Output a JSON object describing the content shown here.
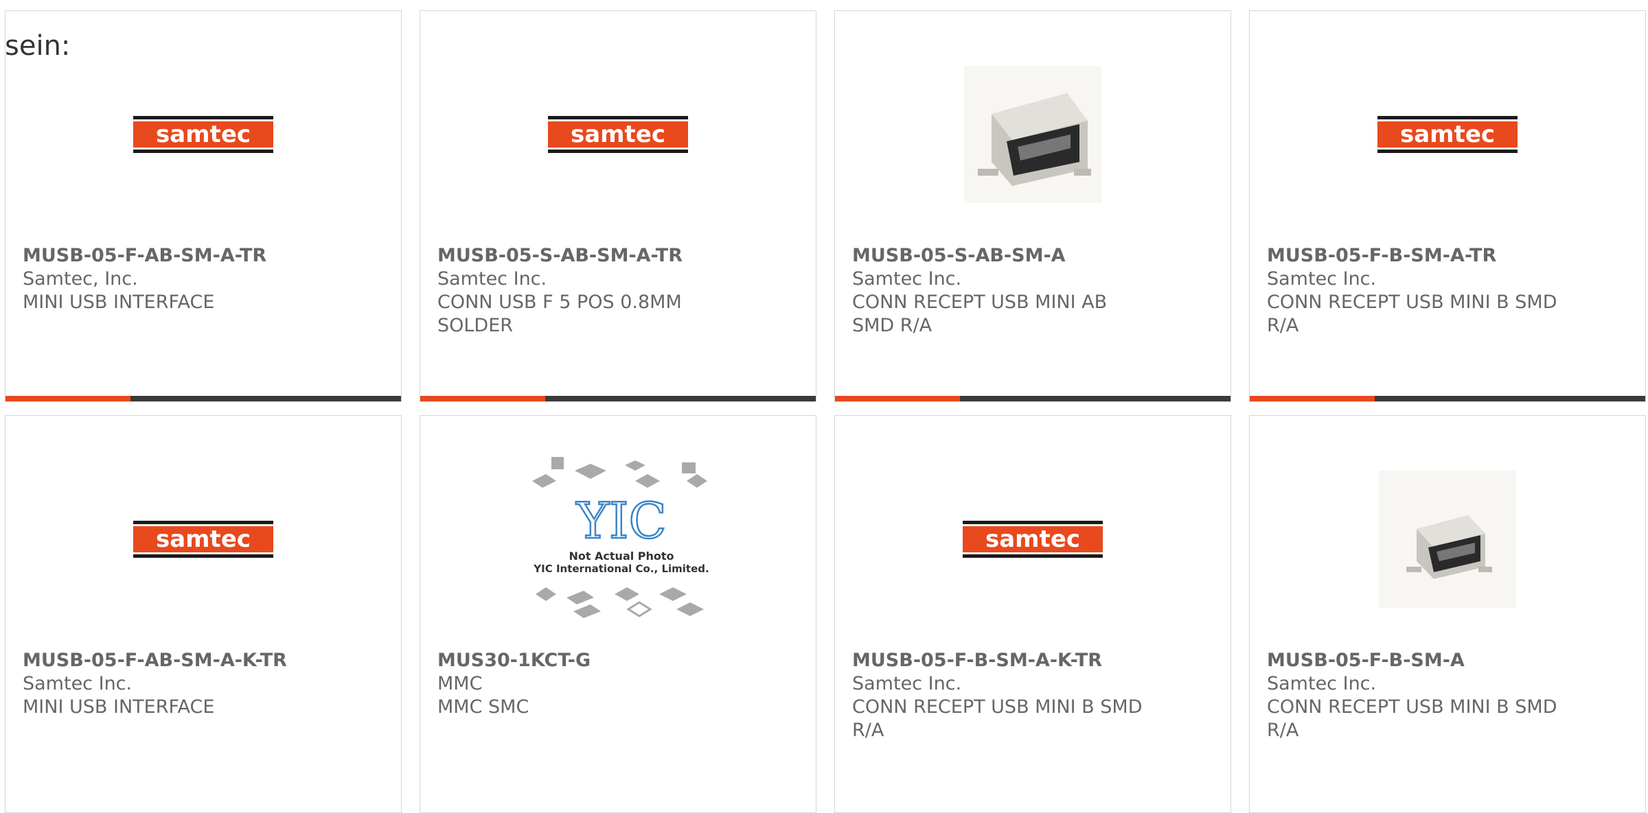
{
  "lead_text": "sein:",
  "colors": {
    "accent": "#e8491d",
    "bar_dark": "#3a3a3a",
    "samtec_orange": "#e8491d",
    "text": "#666666"
  },
  "products": [
    {
      "part": "MUSB-05-F-AB-SM-A-TR",
      "maker": "Samtec, Inc.",
      "desc": "MINI USB INTERFACE",
      "image": "samtec-logo"
    },
    {
      "part": "MUSB-05-S-AB-SM-A-TR",
      "maker": "Samtec Inc.",
      "desc": "CONN USB F 5 POS 0.8MM SOLDER",
      "image": "samtec-logo"
    },
    {
      "part": "MUSB-05-S-AB-SM-A",
      "maker": "Samtec Inc.",
      "desc": "CONN RECEPT USB MINI AB SMD R/A",
      "image": "usb-connector-photo"
    },
    {
      "part": "MUSB-05-F-B-SM-A-TR",
      "maker": "Samtec Inc.",
      "desc": "CONN RECEPT USB MINI B SMD R/A",
      "image": "samtec-logo"
    },
    {
      "part": "MUSB-05-F-AB-SM-A-K-TR",
      "maker": "Samtec Inc.",
      "desc": "MINI USB INTERFACE",
      "image": "samtec-logo"
    },
    {
      "part": "MUS30-1KCT-G",
      "maker": "MMC",
      "desc": "MMC SMC",
      "image": "yic-placeholder"
    },
    {
      "part": "MUSB-05-F-B-SM-A-K-TR",
      "maker": "Samtec Inc.",
      "desc": "CONN RECEPT USB MINI B SMD R/A",
      "image": "samtec-logo"
    },
    {
      "part": "MUSB-05-F-B-SM-A",
      "maker": "Samtec Inc.",
      "desc": "CONN RECEPT USB MINI B SMD R/A",
      "image": "usb-connector-photo"
    }
  ],
  "logos": {
    "samtec": "samtec",
    "yic": "YIC",
    "yic_note_1": "Not Actual Photo",
    "yic_note_2": "YIC International Co., Limited."
  }
}
